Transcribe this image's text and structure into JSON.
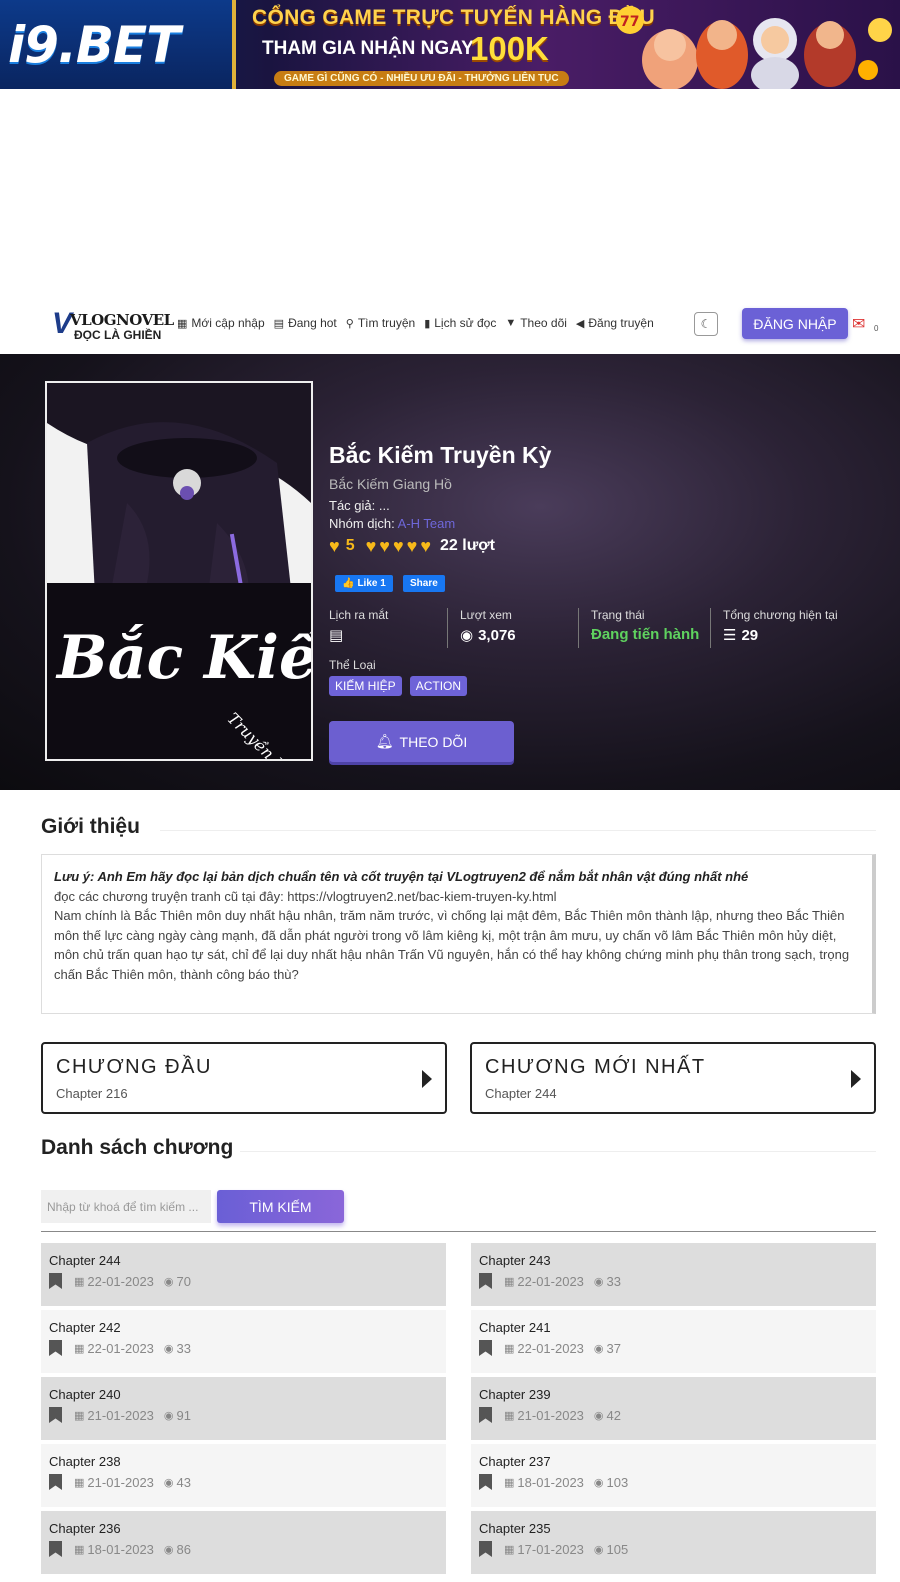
{
  "ad": {
    "logo": "i9.BET",
    "line1": "CỔNG GAME TRỰC TUYẾN HÀNG ĐẦU",
    "line2": "THAM GIA NHẬN NGAY",
    "amount": "100K",
    "line3": "GAME GÌ CŨNG CÓ - NHIỀU ƯU ĐÃI - THƯỞNG LIÊN TỤC"
  },
  "nav": {
    "brand_top": "VLOGNOVEL",
    "brand_bottom": "ĐỌC LÀ GHIỀN",
    "links": [
      {
        "label": "Mới cập nhập",
        "icon": "grid-icon"
      },
      {
        "label": "Đang hot",
        "icon": "newspaper-icon"
      },
      {
        "label": "Tìm truyện",
        "icon": "search-icon"
      },
      {
        "label": "Lịch sử đọc",
        "icon": "book-icon"
      },
      {
        "label": "Theo dõi",
        "icon": "bookmark-icon"
      },
      {
        "label": "Đăng truyện",
        "icon": "megaphone-icon"
      }
    ],
    "login": "ĐĂNG NHẬP",
    "notif_count": "0"
  },
  "manga": {
    "title": "Bắc Kiếm Truyền Kỳ",
    "alt_title": "Bắc Kiếm Giang Hồ",
    "author_label": "Tác giả:",
    "author": "...",
    "group_label": "Nhóm dịch:",
    "group": "A-H Team",
    "rating": "5",
    "rating_hearts": 5,
    "votes": "22 lượt",
    "fb_like": "Like 1",
    "fb_share": "Share",
    "stats": {
      "release_label": "Lịch ra mắt",
      "views_label": "Lượt xem",
      "views": "3,076",
      "status_label": "Trạng thái",
      "status": "Đang tiến hành",
      "chapters_label": "Tổng chương hiện tại",
      "chapters": "29"
    },
    "genre_label": "Thể Loại",
    "genres": [
      "KIẾM HIỆP",
      "ACTION"
    ],
    "follow": "THEO DÕI",
    "cover_text": "Bắc Kiếm",
    "cover_sub": "Truyền Kỳ"
  },
  "intro": {
    "heading": "Giới thiệu",
    "note": "Lưu ý: Anh Em hãy đọc lại bản dịch chuẩn tên và cốt truyện tại VLogtruyen2 để nắm bắt nhân vật đúng nhất nhé",
    "line2": "đọc các chương truyện tranh cũ tại đây: https://vlogtruyen2.net/bac-kiem-truyen-ky.html",
    "body": "Nam chính là Bắc Thiên môn duy nhất hậu nhân, trăm năm trước, vì chống lại mật đêm, Bắc Thiên môn thành lập, nhưng theo Bắc Thiên môn thế lực càng ngày càng mạnh, đã dẫn phát người trong võ lâm kiêng kị, một trận âm mưu, uy chấn võ lâm Bắc Thiên môn hủy diệt, môn chủ trấn quan hạo tự sát, chỉ để lại duy nhất hậu nhân Trấn Vũ nguyên, hắn có thể hay không chứng minh phụ thân trong sạch, trọng chấn Bắc Thiên môn, thành công báo thù?"
  },
  "first_chapter": {
    "heading": "CHƯƠNG ĐẦU",
    "chapter": "Chapter 216"
  },
  "latest_chapter": {
    "heading": "CHƯƠNG MỚI NHẤT",
    "chapter": "Chapter 244"
  },
  "list": {
    "heading": "Danh sách chương",
    "search_placeholder": "Nhập từ khoá để tìm kiếm ...",
    "search_button": "TÌM KIẾM",
    "chapters": [
      {
        "name": "Chapter 244",
        "date": "22-01-2023",
        "views": "70"
      },
      {
        "name": "Chapter 243",
        "date": "22-01-2023",
        "views": "33"
      },
      {
        "name": "Chapter 242",
        "date": "22-01-2023",
        "views": "33"
      },
      {
        "name": "Chapter 241",
        "date": "22-01-2023",
        "views": "37"
      },
      {
        "name": "Chapter 240",
        "date": "21-01-2023",
        "views": "91"
      },
      {
        "name": "Chapter 239",
        "date": "21-01-2023",
        "views": "42"
      },
      {
        "name": "Chapter 238",
        "date": "21-01-2023",
        "views": "43"
      },
      {
        "name": "Chapter 237",
        "date": "18-01-2023",
        "views": "103"
      },
      {
        "name": "Chapter 236",
        "date": "18-01-2023",
        "views": "86"
      },
      {
        "name": "Chapter 235",
        "date": "17-01-2023",
        "views": "105"
      }
    ]
  }
}
